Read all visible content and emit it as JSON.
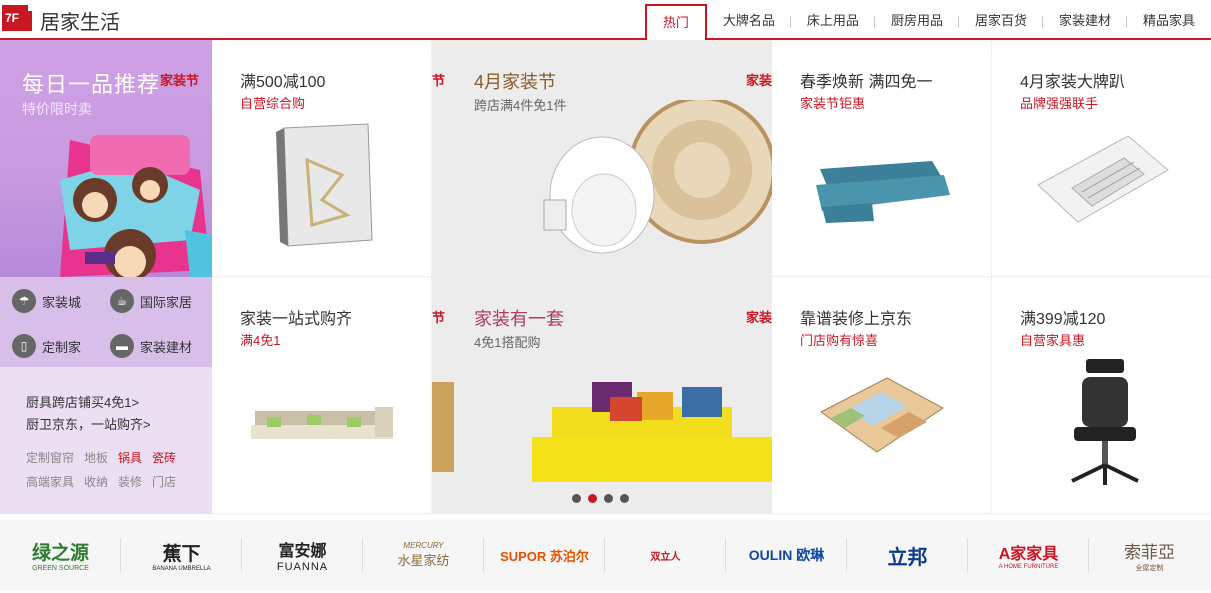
{
  "header": {
    "floor_badge": "7F",
    "title": "居家生活",
    "tabs": [
      {
        "label": "热门",
        "active": true
      },
      {
        "label": "大牌名品"
      },
      {
        "label": "床上用品"
      },
      {
        "label": "厨房用品"
      },
      {
        "label": "居家百货"
      },
      {
        "label": "家装建材"
      },
      {
        "label": "精品家具"
      }
    ]
  },
  "left": {
    "title": "每日一品推荐",
    "tag": "家装节",
    "subtitle": "特价限时卖",
    "quick_links": [
      {
        "label": "家装城",
        "icon": "umbrella-icon"
      },
      {
        "label": "国际家居",
        "icon": "cup-icon"
      },
      {
        "label": "定制家",
        "icon": "wardrobe-icon"
      },
      {
        "label": "家装建材",
        "icon": "sofa-icon"
      }
    ],
    "links": [
      "厨具跨店铺买4免1>",
      "厨卫京东，一站购齐>"
    ],
    "tags": [
      {
        "label": "定制窗帘"
      },
      {
        "label": "地板"
      },
      {
        "label": "锅具",
        "hot": true
      },
      {
        "label": "瓷砖",
        "hot": true
      },
      {
        "label": "高端家具"
      },
      {
        "label": "收纳"
      },
      {
        "label": "装修"
      },
      {
        "label": "门店"
      }
    ]
  },
  "cells": {
    "c1": {
      "title": "满500减100",
      "sub": "自营综合购",
      "image": "mattress-image"
    },
    "c2": {
      "title": "家装一站式购齐",
      "sub": "满4免1",
      "image": "sofa-image"
    },
    "c3": {
      "title": "春季焕新 满四免一",
      "sub": "家装节钜惠",
      "image": "blue-sofa-image"
    },
    "c4": {
      "title": "4月家装大牌趴",
      "sub": "品牌强强联手",
      "image": "ceiling-heater-image"
    },
    "c5": {
      "title": "靠谱装修上京东",
      "sub": "门店购有惊喜",
      "image": "floorplan-image"
    },
    "c6": {
      "title": "满399减120",
      "sub": "自营家具惠",
      "image": "office-chair-image"
    }
  },
  "carousel": {
    "slide1": {
      "title": "4月家装节",
      "sub": "跨店满4件免1件",
      "tag": "家装",
      "tag_left": "节"
    },
    "slide2": {
      "title": "家装有一套",
      "sub": "4免1搭配购",
      "tag": "家装",
      "tag_left": "节"
    },
    "dots": 4,
    "active_dot": 2
  },
  "brands": [
    {
      "name": "绿之源",
      "sub": "GREEN SOURCE",
      "color": "#2e7d32"
    },
    {
      "name": "蕉下",
      "sub": "BANANA UMBRELLA",
      "color": "#222222"
    },
    {
      "name": "富安娜",
      "sub": "FUANNA",
      "color": "#222222"
    },
    {
      "name": "水星家纺",
      "sub": "MERCURY",
      "color": "#8a6a3a"
    },
    {
      "name": "SUPOR 苏泊尔",
      "color": "#e65100"
    },
    {
      "name": "双立人",
      "color": "#c81623"
    },
    {
      "name": "OULIN 欧琳",
      "color": "#0d47a1"
    },
    {
      "name": "立邦",
      "color": "#0d3c8c"
    },
    {
      "name": "A家家具",
      "sub": "A HOME FURNITURE",
      "color": "#c81623"
    },
    {
      "name": "索菲亞",
      "sub": "全屋定制",
      "color": "#6d5a44"
    }
  ]
}
